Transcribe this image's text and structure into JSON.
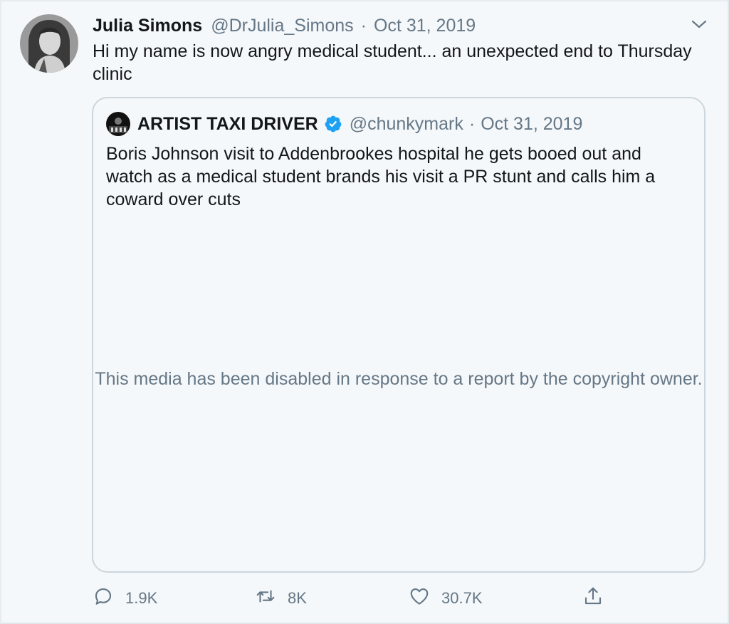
{
  "tweet": {
    "author_name": "Julia Simons",
    "author_handle": "@DrJulia_Simons",
    "separator": "·",
    "date": "Oct 31, 2019",
    "text": "Hi my name is now angry medical student... an unexpected end to Thursday clinic",
    "avatar_icon": "profile-photo",
    "menu_icon": "chevron-down-icon"
  },
  "quoted_tweet": {
    "author_name": "ARTIST TAXI DRIVER",
    "verified": true,
    "author_handle": "@chunkymark",
    "separator": "·",
    "date": "Oct 31, 2019",
    "text": "Boris Johnson visit to Addenbrookes hospital he gets booed out and watch as a medical student brands his visit a PR stunt and calls him a coward over cuts",
    "media_notice": "This media has been disabled in response to a report by the copyright owner."
  },
  "actions": {
    "reply": {
      "icon": "reply-icon",
      "count": "1.9K"
    },
    "retweet": {
      "icon": "retweet-icon",
      "count": "8K"
    },
    "like": {
      "icon": "heart-icon",
      "count": "30.7K"
    },
    "share": {
      "icon": "share-icon"
    }
  },
  "colors": {
    "background": "#f5f8fa",
    "text_primary": "#14171a",
    "text_secondary": "#657786",
    "border": "#ccd6dd",
    "verified_blue": "#1da1f2"
  }
}
